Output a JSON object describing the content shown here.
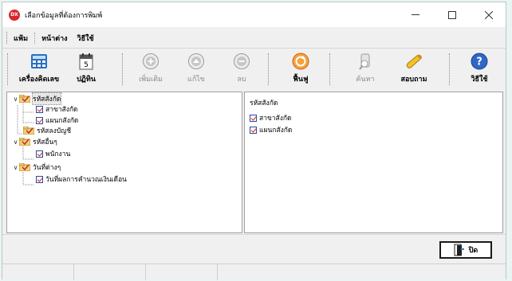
{
  "window": {
    "title": "เลือกข้อมูลที่ต้องการพิมพ์",
    "app_icon_text": "DX"
  },
  "menu": [
    "แฟ้ม",
    "หน้าต่าง",
    "วิธีใช้"
  ],
  "toolbar": {
    "calculator_label": "เครื่องคิดเลข",
    "calendar_label": "ปฏิทิน",
    "add_label": "เพิ่มเติม",
    "edit_label": "แก้ไข",
    "delete_label": "ลบ",
    "restore_label": "ฟื้นฟู",
    "search_label": "ค้นหา",
    "inquiry_label": "สอบถาม",
    "help_label": "วิธีใช้"
  },
  "tree": {
    "items": [
      {
        "label": "รหัสสังกัด"
      },
      {
        "label": "สาขาสังกัด"
      },
      {
        "label": "แผนกสังกัด"
      },
      {
        "label": "รหัสลงบัญชี"
      },
      {
        "label": "รหัสอื่นๆ"
      },
      {
        "label": "พนักงาน"
      },
      {
        "label": "วันที่ต่างๆ"
      },
      {
        "label": "วันที่ผลการคำนวณเงินเดือน"
      }
    ]
  },
  "detail": {
    "header": "รหัสสังกัด",
    "items": [
      "สาขาสังกัด",
      "แผนกสังกัด"
    ]
  },
  "close_button": {
    "label": "ปิด"
  }
}
